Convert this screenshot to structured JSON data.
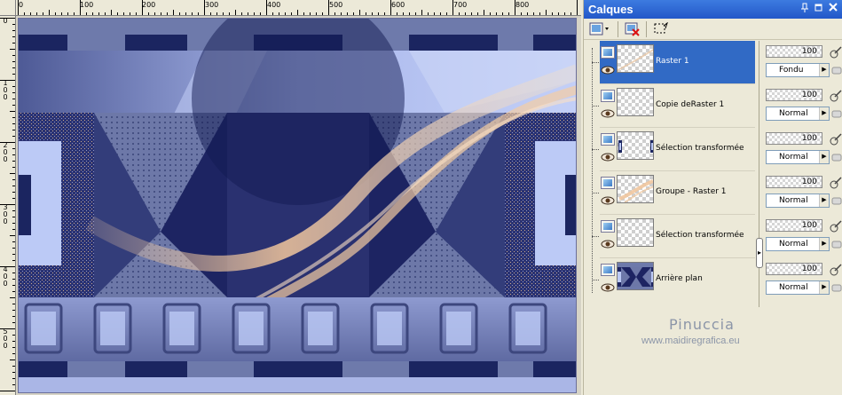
{
  "ruler": {
    "top_labels": [
      "0",
      "100",
      "200",
      "300",
      "400",
      "500",
      "600",
      "700",
      "800"
    ],
    "left_labels": [
      "0",
      "100",
      "200",
      "300",
      "400",
      "500"
    ]
  },
  "panel": {
    "title": "Calques",
    "pin_icon": "pin-icon",
    "close_icon": "close-icon"
  },
  "layers": [
    {
      "name": "Raster 1",
      "opacity": "100",
      "blend": "Fondu",
      "selected": true,
      "thumb": "transparent-ribbon"
    },
    {
      "name": "Copie deRaster 1",
      "opacity": "100",
      "blend": "Normal",
      "selected": false,
      "thumb": "transparent"
    },
    {
      "name": "Sélection transformée",
      "opacity": "100",
      "blend": "Normal",
      "selected": false,
      "thumb": "frame-sides"
    },
    {
      "name": "Groupe - Raster 1",
      "opacity": "100",
      "blend": "Normal",
      "selected": false,
      "thumb": "ribbon"
    },
    {
      "name": "Sélection transformée",
      "opacity": "100",
      "blend": "Normal",
      "selected": false,
      "thumb": "transparent"
    },
    {
      "name": "Arrière plan",
      "opacity": "100",
      "blend": "Normal",
      "selected": false,
      "thumb": "background"
    }
  ],
  "watermark": {
    "name": "Pinuccia",
    "url": "www.maidiregrafica.eu"
  },
  "colors": {
    "navy": "#1b2560",
    "slate": "#6a75a6",
    "pale_blue": "#bccaf6",
    "peach": "#f1c79e",
    "selection": "#316ac5",
    "titlebar": "#2f6bd8"
  }
}
